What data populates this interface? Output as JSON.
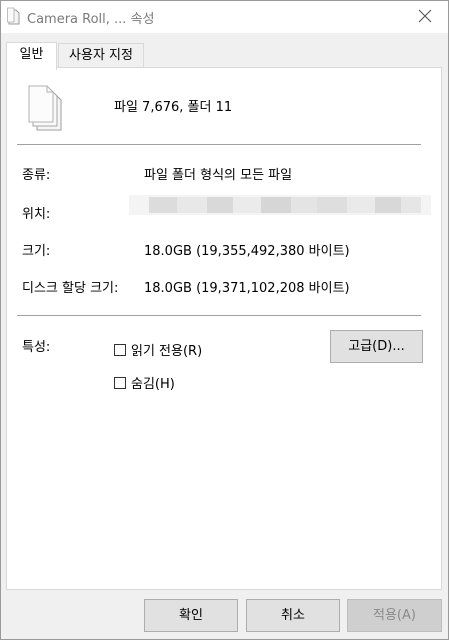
{
  "window": {
    "title": "Camera Roll, ... 속성",
    "close_label": "×"
  },
  "tabs": [
    {
      "label": "일반",
      "active": true
    },
    {
      "label": "사용자 지정",
      "active": false
    }
  ],
  "summary": {
    "text": "파일 7,676, 폴더 11"
  },
  "details": {
    "type_label": "종류:",
    "type_value": "파일 폴더 형식의 모든 파일",
    "location_label": "위치:",
    "location_value_blurred": true,
    "size_label": "크기:",
    "size_value": "18.0GB (19,355,492,380 바이트)",
    "disk_size_label": "디스크 할당 크기:",
    "disk_size_value": "18.0GB (19,371,102,208 바이트)"
  },
  "attributes": {
    "label": "특성:",
    "readonly_label": "읽기 전용(R)",
    "readonly_checked": false,
    "hidden_label": "숨김(H)",
    "hidden_checked": false,
    "advanced_button": "고급(D)..."
  },
  "buttons": {
    "ok": "확인",
    "cancel": "취소",
    "apply": "적용(A)",
    "apply_enabled": false
  },
  "icons": {
    "title_icon": "document-icon",
    "folder_icon": "multiple-files-icon",
    "close_icon": "close-icon"
  },
  "colors": {
    "window_bg": "#f0f0f0",
    "panel_bg": "#ffffff",
    "button_bg": "#e1e1e1",
    "disabled_text": "#8a8a8a"
  }
}
